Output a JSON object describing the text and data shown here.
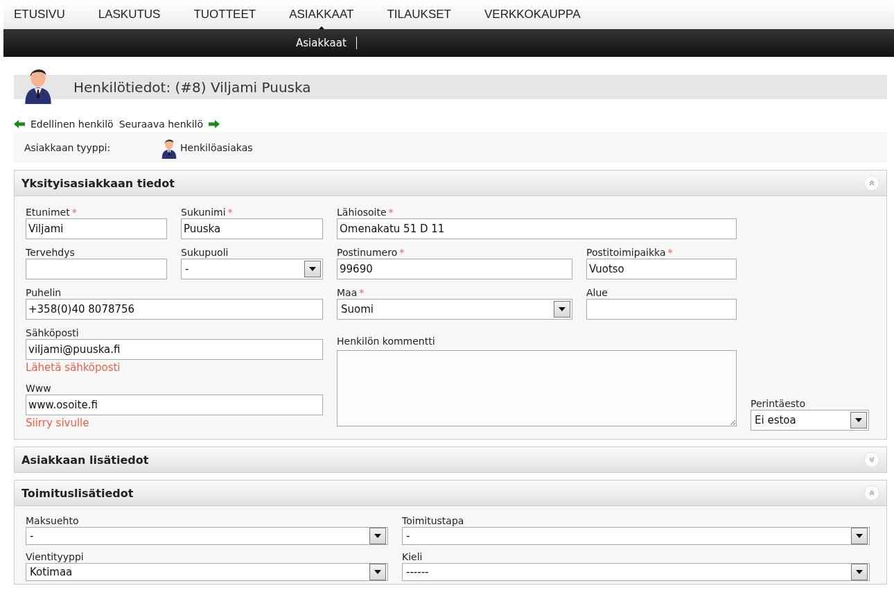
{
  "top_nav": [
    {
      "label": "ETUSIVU",
      "selected": false
    },
    {
      "label": "LASKUTUS",
      "selected": false
    },
    {
      "label": "TUOTTEET",
      "selected": false
    },
    {
      "label": "ASIAKKAAT",
      "selected": true
    },
    {
      "label": "TILAUKSET",
      "selected": false
    },
    {
      "label": "VERKKOKAUPPA",
      "selected": false
    }
  ],
  "sub_nav": [
    {
      "label": "Asiakkaat"
    }
  ],
  "page_title": "Henkilötiedot: (#8) Viljami Puuska",
  "record_nav": {
    "previous": "Edellinen henkilö",
    "next": "Seuraava henkilö"
  },
  "customer_type": {
    "label": "Asiakkaan tyyppi:",
    "value": "Henkilöasiakas"
  },
  "sections": [
    {
      "title": "Yksityisasiakkaan tiedot",
      "expanded": true,
      "fields": [
        {
          "kind": "text",
          "label": "Etunimet",
          "required_mark": "*",
          "value": "Viljami"
        },
        {
          "kind": "text",
          "label": "Sukunimi",
          "required_mark": "*",
          "value": "Puuska"
        },
        {
          "kind": "text",
          "label": "Lähiosoite",
          "required_mark": "*",
          "value": "Omenakatu 51 D 11"
        },
        {
          "kind": "text",
          "label": "Tervehdys"
        },
        {
          "kind": "select",
          "label": "Sukupuoli",
          "value": "-"
        },
        {
          "kind": "text",
          "label": "Postinumero",
          "required_mark": "*",
          "value": "99690"
        },
        {
          "kind": "text",
          "label": "Postitoimipaikka",
          "required_mark": "*",
          "value": "Vuotso"
        },
        {
          "kind": "text",
          "label": "Puhelin",
          "value": "+358(0)40 8078756"
        },
        {
          "kind": "select",
          "label": "Maa",
          "required_mark": "*",
          "value": "Suomi"
        },
        {
          "kind": "text",
          "label": "Alue"
        },
        {
          "kind": "text",
          "label": "Sähköposti",
          "value": "viljami@puuska.fi",
          "link": "Lähetä sähköposti"
        },
        {
          "kind": "text",
          "label": "Www",
          "value": "www.osoite.fi",
          "link": "Siirry sivulle"
        },
        {
          "kind": "textarea",
          "label": "Henkilön kommentti"
        },
        {
          "kind": "select",
          "label": "Perintäesto",
          "value": "Ei estoa"
        }
      ]
    },
    {
      "title": "Asiakkaan lisätiedot",
      "expanded": false
    },
    {
      "title": "Toimituslisätiedot",
      "expanded": true,
      "fields": [
        {
          "kind": "select",
          "label": "Maksuehto",
          "value": "-"
        },
        {
          "kind": "select",
          "label": "Toimitustapa",
          "value": "-"
        },
        {
          "kind": "select",
          "label": "Vientityyppi",
          "value": "Kotimaa"
        },
        {
          "kind": "select",
          "label": "Kieli",
          "value": "------"
        }
      ]
    }
  ]
}
